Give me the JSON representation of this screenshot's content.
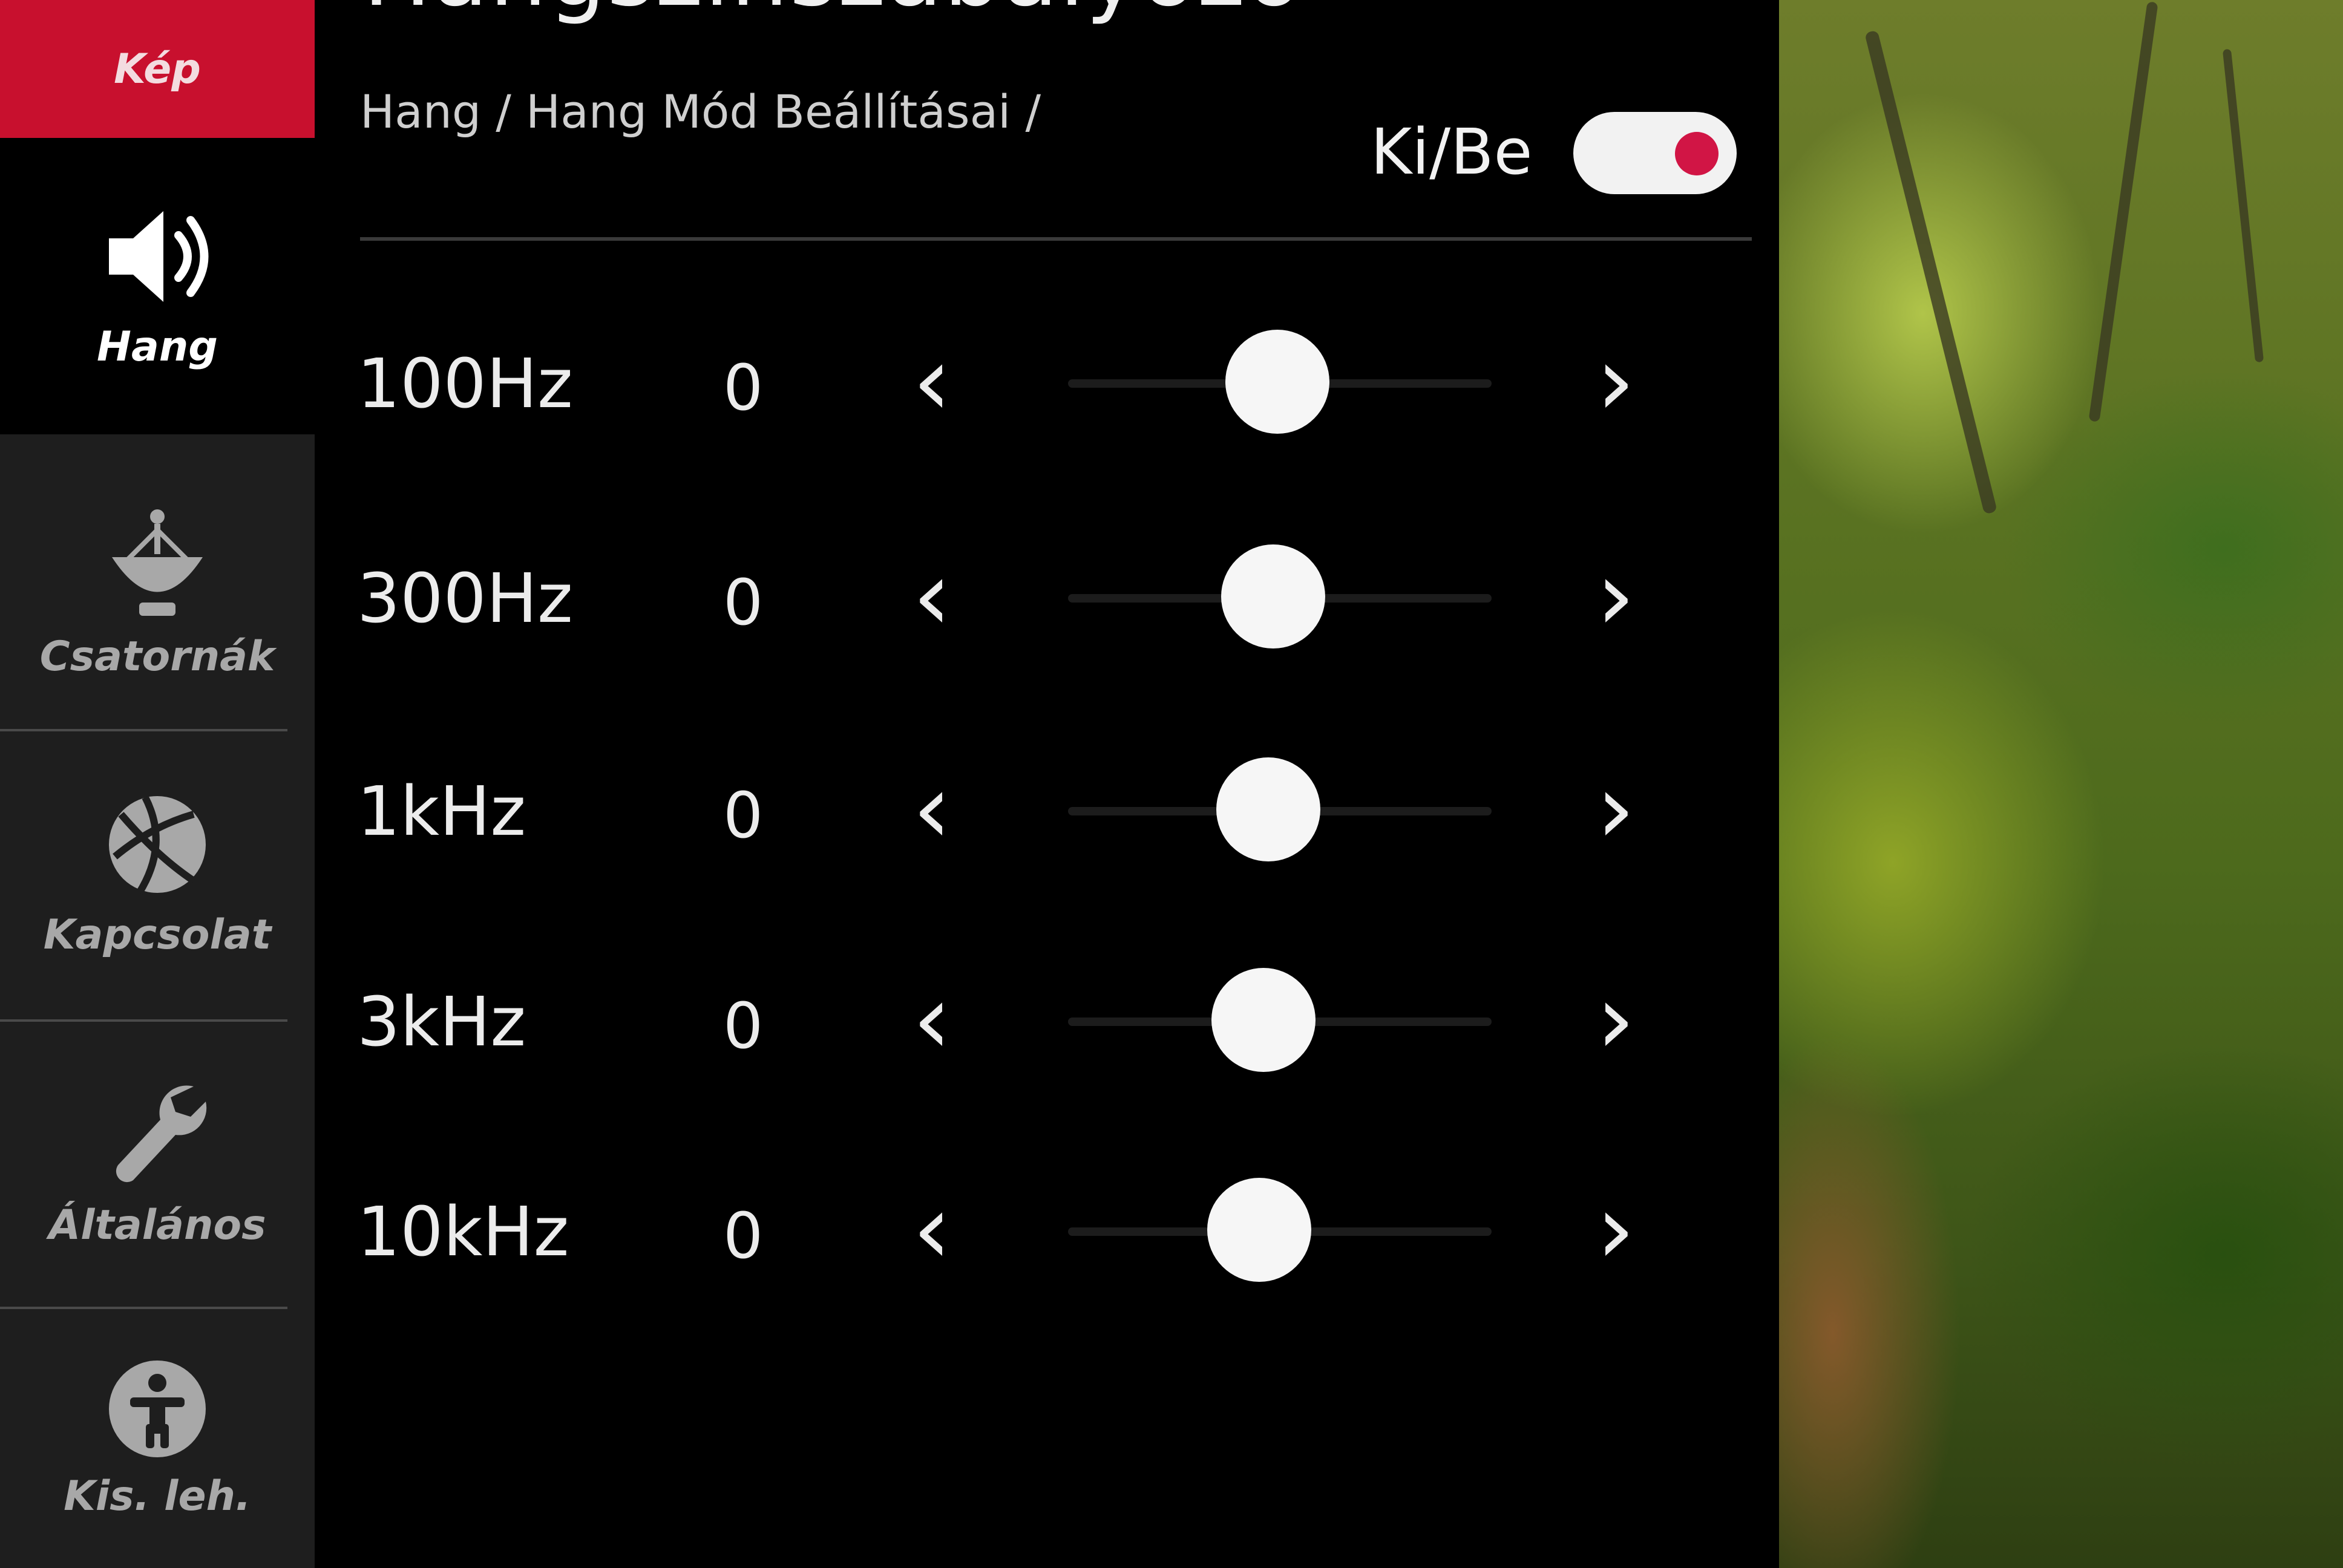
{
  "sidebar": {
    "items": [
      {
        "label": "Kép",
        "icon": "picture-icon"
      },
      {
        "label": "Hang",
        "icon": "speaker-icon"
      },
      {
        "label": "Csatornák",
        "icon": "satellite-dish-icon"
      },
      {
        "label": "Kapcsolat",
        "icon": "network-globe-icon"
      },
      {
        "label": "Általános",
        "icon": "wrench-icon"
      },
      {
        "label": "Kis. leh.",
        "icon": "accessibility-icon"
      }
    ]
  },
  "header": {
    "title": "Hangszínszabályozó",
    "breadcrumb": "Hang / Hang Mód Beállításai /",
    "toggle_label": "Ki/Be",
    "toggle_on": true
  },
  "equalizer": {
    "bands": [
      {
        "label": "100Hz",
        "value": "0"
      },
      {
        "label": "300Hz",
        "value": "0"
      },
      {
        "label": "1kHz",
        "value": "0"
      },
      {
        "label": "3kHz",
        "value": "0"
      },
      {
        "label": "10kHz",
        "value": "0"
      }
    ],
    "decrease_symbol": "‹",
    "increase_symbol": "›"
  },
  "colors": {
    "accent": "#c8102e",
    "toggle_knob": "#d11545",
    "panel_bg": "#000000",
    "sidebar_bg": "#1e1e1e"
  }
}
